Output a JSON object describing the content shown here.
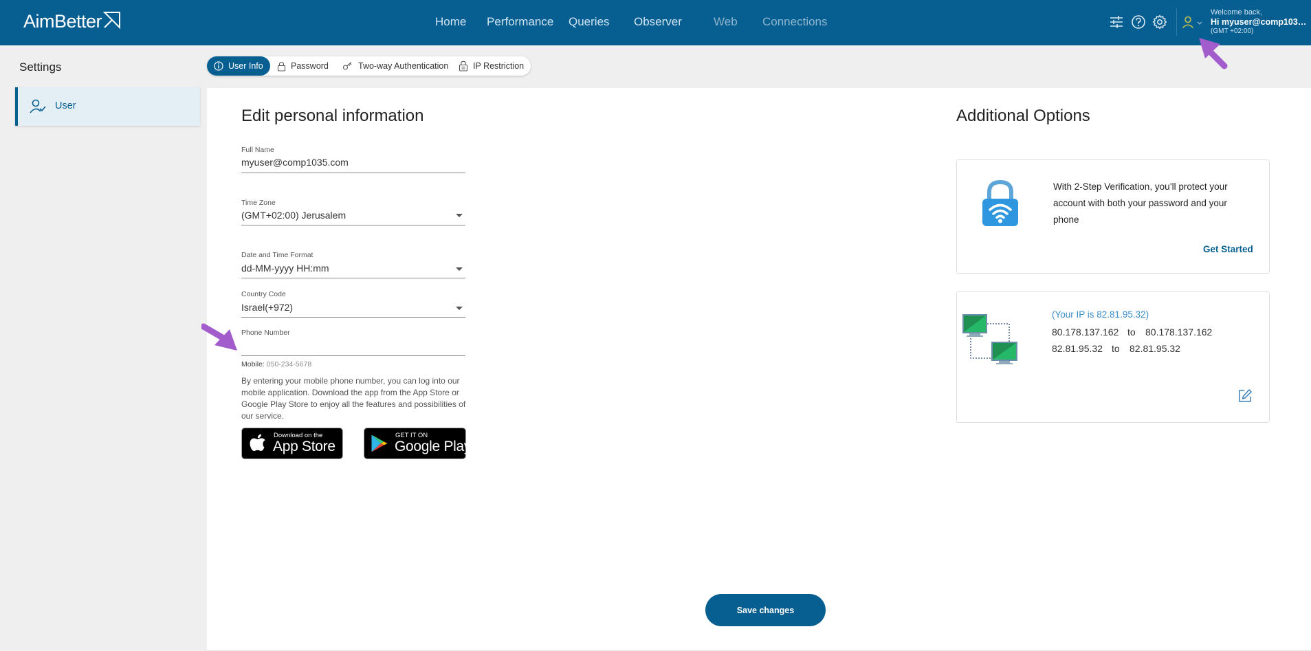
{
  "brand": {
    "name": "AimBetter"
  },
  "nav": {
    "items": [
      {
        "label": "Home"
      },
      {
        "label": "Performance"
      },
      {
        "label": "Queries"
      },
      {
        "label": "Observer"
      },
      {
        "label": "Web"
      },
      {
        "label": "Connections"
      }
    ]
  },
  "topbar": {
    "icons": [
      "sliders-icon",
      "help-icon",
      "gear-icon",
      "user-icon"
    ],
    "welcome_line1": "Welcome back,",
    "welcome_line2": "Hi myuser@comp1035...",
    "welcome_line3": "(GMT +02:00)"
  },
  "sidebar": {
    "title": "Settings",
    "items": [
      {
        "label": "User",
        "icon": "user-check-icon"
      }
    ]
  },
  "tabs": [
    {
      "label": "User Info",
      "icon": "info-icon",
      "active": true
    },
    {
      "label": "Password",
      "icon": "lock-icon",
      "active": false
    },
    {
      "label": "Two-way Authentication",
      "icon": "key-icon",
      "active": false
    },
    {
      "label": "IP Restriction",
      "icon": "padlock-icon",
      "active": false
    }
  ],
  "form": {
    "title": "Edit personal information",
    "full_name": {
      "label": "Full Name",
      "value": "myuser@comp1035.com"
    },
    "time_zone": {
      "label": "Time Zone",
      "value": "(GMT+02:00) Jerusalem"
    },
    "date_format": {
      "label": "Date and Time Format",
      "value": "dd-MM-yyyy HH:mm"
    },
    "country_code": {
      "label": "Country Code",
      "value": "Israel(+972)"
    },
    "phone": {
      "label": "Phone Number",
      "value": ""
    },
    "mobile_hint_label": "Mobile:",
    "mobile_hint_example": "050-234-5678",
    "description": "By entering your mobile phone number, you can log into our mobile application. Download the app from the App Store or Google Play Store to enjoy all the features and possibilities of our service.",
    "app_store": {
      "small": "Download on the",
      "big": "App Store"
    },
    "google_play": {
      "small": "GET IT ON",
      "big": "Google Play"
    }
  },
  "additional": {
    "title": "Additional Options",
    "two_step": {
      "text": "With 2-Step Verification, you’ll protect your account with both your password and your phone",
      "link": "Get Started"
    },
    "ip": {
      "own_ip": "(Your IP is 82.81.95.32)",
      "ranges": [
        {
          "from": "80.178.137.162",
          "sep": "to",
          "to": "80.178.137.162"
        },
        {
          "from": "82.81.95.32",
          "sep": "to",
          "to": "82.81.95.32"
        }
      ]
    }
  },
  "save_label": "Save changes",
  "colors": {
    "primary": "#075f91",
    "accent_arrow": "#9b59c9",
    "link": "#3b8fcb"
  }
}
